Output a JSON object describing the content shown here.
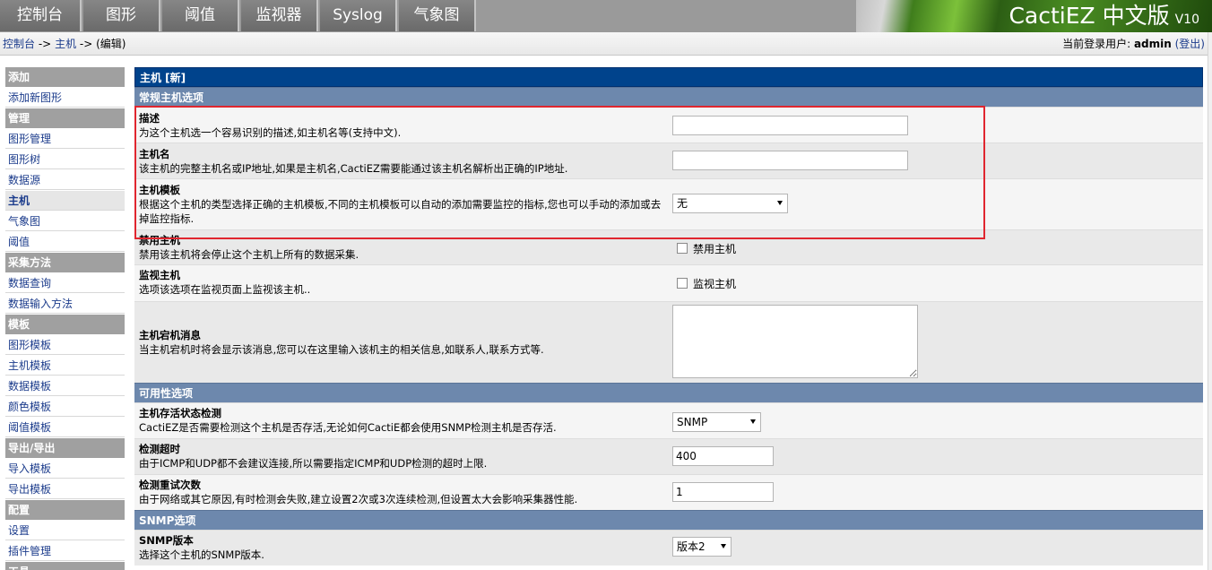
{
  "topnav": {
    "tabs": [
      {
        "label": "控制台"
      },
      {
        "label": "图形"
      },
      {
        "label": "阈值"
      },
      {
        "label": "监视器"
      },
      {
        "label": "Syslog"
      },
      {
        "label": "气象图"
      }
    ],
    "brand": "CactiEZ 中文版",
    "brand_version": "V10"
  },
  "breadcrumb": {
    "console": "控制台",
    "sep": "->",
    "host": "主机",
    "current": "(编辑)"
  },
  "user": {
    "prefix": "当前登录用户:",
    "name": "admin",
    "logout": "(登出)"
  },
  "sidebar": {
    "groups": [
      {
        "title": "添加",
        "items": [
          "添加新图形"
        ]
      },
      {
        "title": "管理",
        "items": [
          "图形管理",
          "图形树",
          "数据源",
          "主机",
          "气象图",
          "阈值"
        ]
      },
      {
        "title": "采集方法",
        "items": [
          "数据查询",
          "数据输入方法"
        ]
      },
      {
        "title": "模板",
        "items": [
          "图形模板",
          "主机模板",
          "数据模板",
          "颜色模板",
          "阈值模板"
        ]
      },
      {
        "title": "导出/导出",
        "items": [
          "导入模板",
          "导出模板"
        ]
      },
      {
        "title": "配置",
        "items": [
          "设置",
          "插件管理"
        ]
      },
      {
        "title": "工具",
        "items": []
      }
    ],
    "active_item": "主机"
  },
  "main": {
    "title": "主机 [新]",
    "sections": {
      "general": "常规主机选项",
      "availability": "可用性选项",
      "snmp": "SNMP选项"
    },
    "fields": {
      "description": {
        "label": "描述",
        "help": "为这个主机选一个容易识别的描述,如主机名等(支持中文).",
        "value": ""
      },
      "hostname": {
        "label": "主机名",
        "help": "该主机的完整主机名或IP地址,如果是主机名,CactiEZ需要能通过该主机名解析出正确的IP地址.",
        "value": ""
      },
      "template": {
        "label": "主机模板",
        "help": "根据这个主机的类型选择正确的主机模板,不同的主机模板可以自动的添加需要监控的指标,您也可以手动的添加或去掉监控指标.",
        "value": "无"
      },
      "disable": {
        "label": "禁用主机",
        "help": "禁用该主机将会停止这个主机上所有的数据采集.",
        "checkbox_label": "禁用主机"
      },
      "monitor": {
        "label": "监视主机",
        "help": "选项该选项在监视页面上监视该主机..",
        "checkbox_label": "监视主机"
      },
      "down_msg": {
        "label": "主机宕机消息",
        "help": "当主机宕机时将会显示该消息,您可以在这里输入该机主的相关信息,如联系人,联系方式等.",
        "value": ""
      },
      "availability_method": {
        "label": "主机存活状态检测",
        "help": "CactiEZ是否需要检测这个主机是否存活,无论如何CactiE都会使用SNMP检测主机是否存活.",
        "value": "SNMP"
      },
      "timeout": {
        "label": "检测超时",
        "help": "由于ICMP和UDP都不会建议连接,所以需要指定ICMP和UDP检测的超时上限.",
        "value": "400"
      },
      "retries": {
        "label": "检测重试次数",
        "help": "由于网络或其它原因,有时检测会失败,建立设置2次或3次连续检测,但设置太大会影响采集器性能.",
        "value": "1"
      },
      "snmp_version": {
        "label": "SNMP版本",
        "help": "选择这个主机的SNMP版本.",
        "value": "版本2"
      }
    }
  }
}
